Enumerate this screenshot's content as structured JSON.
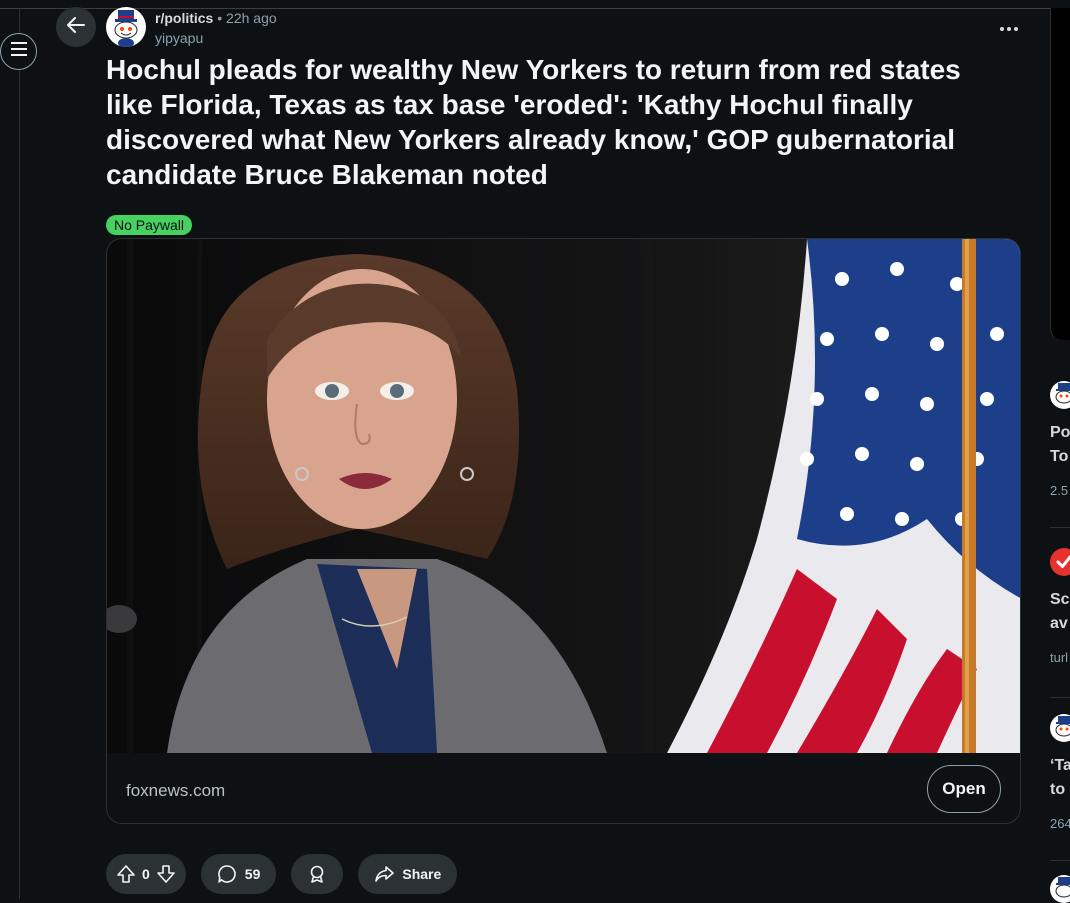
{
  "post": {
    "subreddit": "r/politics",
    "separator": "•",
    "time": "22h ago",
    "username": "yipyapu",
    "title": "Hochul pleads for wealthy New Yorkers to return from red states like Florida, Texas as tax base 'eroded': 'Kathy Hochul finally discovered what New Yorkers already know,' GOP gubernatorial candidate Bruce Blakeman noted",
    "flair": "No Paywall",
    "flair_color": "#46d160"
  },
  "link_card": {
    "domain": "foxnews.com",
    "open_label": "Open"
  },
  "actions": {
    "vote_count": "0",
    "comment_count": "59",
    "share_label": "Share"
  },
  "sidebar_right": {
    "items": [
      {
        "title_line1": "Po",
        "title_line2": "To",
        "meta": "2.5"
      },
      {
        "title_line1": "Sc",
        "title_line2": "av",
        "meta": "turl"
      },
      {
        "title_line1": "‘Ta",
        "title_line2": "to",
        "meta": "264"
      }
    ]
  },
  "colors": {
    "background": "#0e1113",
    "pill": "#2a3236",
    "flag_red": "#c8102e",
    "flag_blue": "#1d3f8a"
  },
  "icons": {
    "menu": "hamburger-icon",
    "back": "arrow-left-icon",
    "more": "overflow-dots-icon",
    "upvote": "arrow-up-icon",
    "downvote": "arrow-down-icon",
    "comment": "speech-bubble-icon",
    "award": "award-icon",
    "share": "share-arrow-icon"
  }
}
